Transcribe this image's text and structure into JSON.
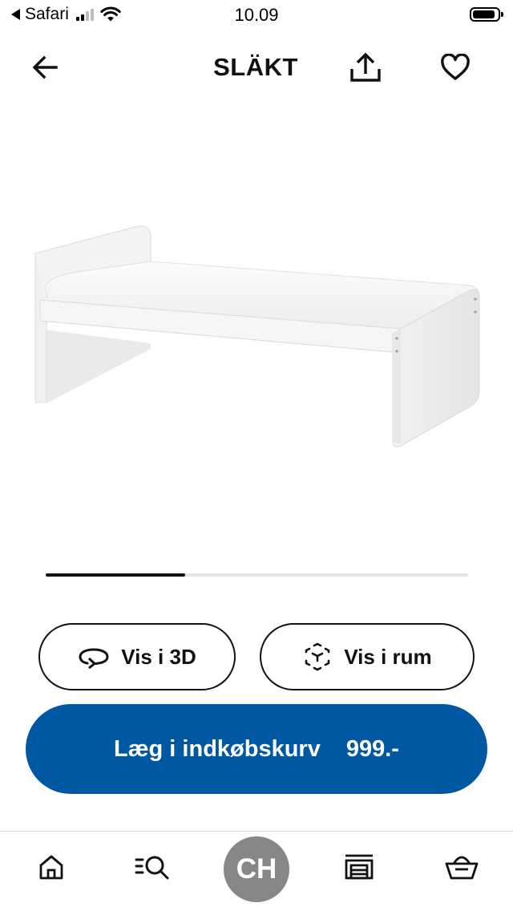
{
  "status_bar": {
    "carrier": "Safari",
    "time": "10.09",
    "signal_bars_active": 2,
    "signal_bars_total": 4,
    "battery_level": 0.9
  },
  "header": {
    "title": "SLÄKT",
    "back_icon": "arrow-left-icon",
    "share_icon": "share-icon",
    "favorite_icon": "heart-icon"
  },
  "carousel": {
    "progress": 0.33
  },
  "actions": {
    "view_3d_label": "Vis i 3D",
    "view_room_label": "Vis i rum"
  },
  "cart": {
    "label": "Læg i indkøbskurv",
    "price": "999.-",
    "color": "#0058a3"
  },
  "tab_bar": {
    "home_icon": "home-icon",
    "search_icon": "search-list-icon",
    "profile_initials": "CH",
    "store_icon": "store-icon",
    "basket_icon": "basket-icon"
  }
}
